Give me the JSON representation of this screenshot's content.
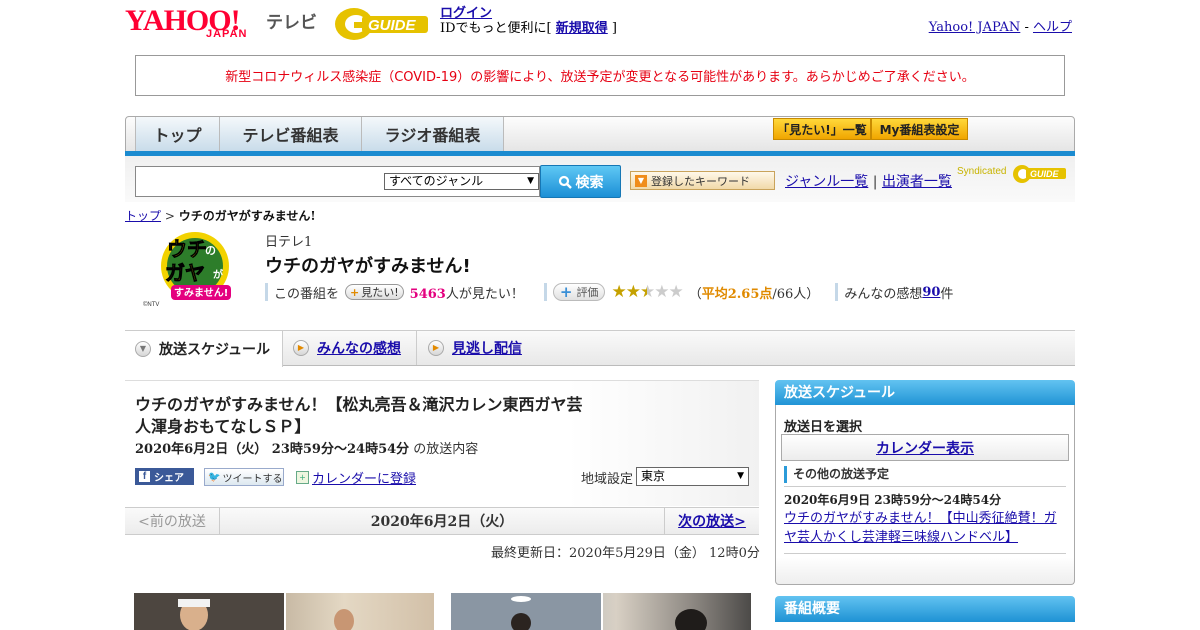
{
  "header": {
    "yahoo_logo": "YAHOO!",
    "yahoo_japan": "JAPAN",
    "tv_label": "テレビ",
    "gguide_logo": "G-GUIDE",
    "login_link": "ログイン",
    "login_text_prefix": "IDでもっと便利に[ ",
    "register_link": "新規取得",
    "login_text_suffix": " ]",
    "yahoo_japan_link": "Yahoo! JAPAN",
    "separator": " - ",
    "help_link": "ヘルプ"
  },
  "notice": {
    "text": "新型コロナウィルス感染症（COVID-19）の影響により、放送予定が変更となる可能性があります。あらかじめご了承ください。"
  },
  "nav": {
    "tabs": [
      {
        "label": "トップ"
      },
      {
        "label": "テレビ番組表"
      },
      {
        "label": "ラジオ番組表"
      }
    ],
    "mitai_list": "「見たい!」一覧",
    "my_schedule": "My番組表設定"
  },
  "search": {
    "input_value": "",
    "genre_selected": "すべてのジャンル",
    "search_button": "検索",
    "keyword_button": "登録したキーワード",
    "genre_list_link": "ジャンル一覧",
    "divider": "|",
    "performer_list_link": "出演者一覧",
    "syndicated": "Syndicated",
    "syndicated_logo": "G-GUIDE"
  },
  "breadcrumb": {
    "top": "トップ",
    "sep": " > ",
    "current": "ウチのガヤがすみません!"
  },
  "program": {
    "logo_text": "ウチのガヤがすみません!",
    "logo_credit": "©NTV",
    "channel": "日テレ1",
    "title": "ウチのガヤがすみません!",
    "watch_prefix": "この番組を",
    "mitai_button": "見たい!",
    "watch_count": "5463",
    "watch_suffix": "人が見たい！",
    "rate_button": "評価",
    "rating": 2.65,
    "avg_open": "（",
    "avg_label": "平均2.65点",
    "avg_count": "/66人）",
    "kanso_prefix": "みんなの感想 ",
    "kanso_count": "90",
    "kanso_suffix": "件"
  },
  "tabs": {
    "schedule": "放送スケジュール",
    "kanso": "みんなの感想",
    "minogashi": "見逃し配信"
  },
  "episode": {
    "title": "ウチのガヤがすみません！【松丸亮吾＆滝沢カレン東西ガヤ芸人渾身おもてなしＳＰ】",
    "date": "2020年6月2日（火）  23時59分～24時54分",
    "date_suffix": "  の放送内容",
    "share": "シェア",
    "tweet": "ツイートする",
    "calendar_register": "カレンダーに登録",
    "region_label": "地域設定",
    "region_selected": "東京",
    "prev": "<前の放送",
    "pager_date": "2020年6月2日（火）",
    "next": "次の放送>",
    "updated": "最終更新日：2020年5月29日（金）  12時0分"
  },
  "sidebar": {
    "schedule_head": "放送スケジュール",
    "pick_date": "放送日を選択",
    "calendar_button": "カレンダー表示",
    "other_head": "その他の放送予定",
    "other_date": "2020年6月9日  23時59分～24時54分",
    "other_title": "ウチのガヤがすみません！【中山秀征絶賛！ガヤ芸人かくし芸津軽三味線ハンドベル】",
    "summary_head": "番組概要"
  },
  "colors": {
    "yahoo_red": "#ff0033",
    "notice_red": "#e60012",
    "accent_blue": "#1b8bd0",
    "watch_count_pink": "#e4007f",
    "rating_orange": "#e08a00"
  }
}
